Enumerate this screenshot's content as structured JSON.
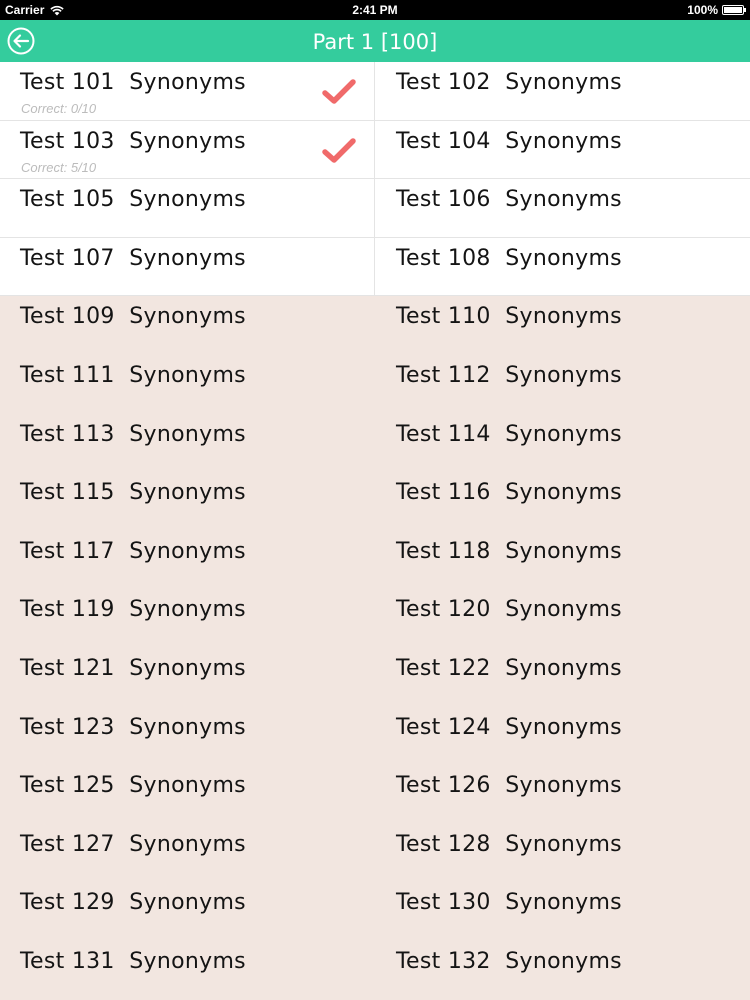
{
  "status_bar": {
    "carrier": "Carrier",
    "time": "2:41 PM",
    "battery": "100%"
  },
  "nav": {
    "title": "Part 1 [100]",
    "back_icon": "back-arrow-circle-icon"
  },
  "colors": {
    "accent": "#34cc9d",
    "check": "#f06a6a",
    "background": "#f2e6e0"
  },
  "tests": [
    {
      "label": "Test 101  Synonyms",
      "score": "Correct: 0/10",
      "checked": true
    },
    {
      "label": "Test 102  Synonyms",
      "score": "",
      "checked": false,
      "opened": true
    },
    {
      "label": "Test 103  Synonyms",
      "score": "Correct: 5/10",
      "checked": true
    },
    {
      "label": "Test 104  Synonyms",
      "score": "",
      "checked": false,
      "opened": true
    },
    {
      "label": "Test 105  Synonyms",
      "score": "",
      "checked": false,
      "opened": true
    },
    {
      "label": "Test 106  Synonyms",
      "score": "",
      "checked": false,
      "opened": true
    },
    {
      "label": "Test 107  Synonyms",
      "score": "",
      "checked": false,
      "opened": true
    },
    {
      "label": "Test 108  Synonyms",
      "score": "",
      "checked": false,
      "opened": true
    },
    {
      "label": "Test 109  Synonyms",
      "score": "",
      "checked": false
    },
    {
      "label": "Test 110  Synonyms",
      "score": "",
      "checked": false
    },
    {
      "label": "Test 111  Synonyms",
      "score": "",
      "checked": false
    },
    {
      "label": "Test 112  Synonyms",
      "score": "",
      "checked": false
    },
    {
      "label": "Test 113  Synonyms",
      "score": "",
      "checked": false
    },
    {
      "label": "Test 114  Synonyms",
      "score": "",
      "checked": false
    },
    {
      "label": "Test 115  Synonyms",
      "score": "",
      "checked": false
    },
    {
      "label": "Test 116  Synonyms",
      "score": "",
      "checked": false
    },
    {
      "label": "Test 117  Synonyms",
      "score": "",
      "checked": false
    },
    {
      "label": "Test 118  Synonyms",
      "score": "",
      "checked": false
    },
    {
      "label": "Test 119  Synonyms",
      "score": "",
      "checked": false
    },
    {
      "label": "Test 120  Synonyms",
      "score": "",
      "checked": false
    },
    {
      "label": "Test 121  Synonyms",
      "score": "",
      "checked": false
    },
    {
      "label": "Test 122  Synonyms",
      "score": "",
      "checked": false
    },
    {
      "label": "Test 123  Synonyms",
      "score": "",
      "checked": false
    },
    {
      "label": "Test 124  Synonyms",
      "score": "",
      "checked": false
    },
    {
      "label": "Test 125  Synonyms",
      "score": "",
      "checked": false
    },
    {
      "label": "Test 126  Synonyms",
      "score": "",
      "checked": false
    },
    {
      "label": "Test 127  Synonyms",
      "score": "",
      "checked": false
    },
    {
      "label": "Test 128  Synonyms",
      "score": "",
      "checked": false
    },
    {
      "label": "Test 129  Synonyms",
      "score": "",
      "checked": false
    },
    {
      "label": "Test 130  Synonyms",
      "score": "",
      "checked": false
    },
    {
      "label": "Test 131  Synonyms",
      "score": "",
      "checked": false
    },
    {
      "label": "Test 132  Synonyms",
      "score": "",
      "checked": false
    }
  ]
}
